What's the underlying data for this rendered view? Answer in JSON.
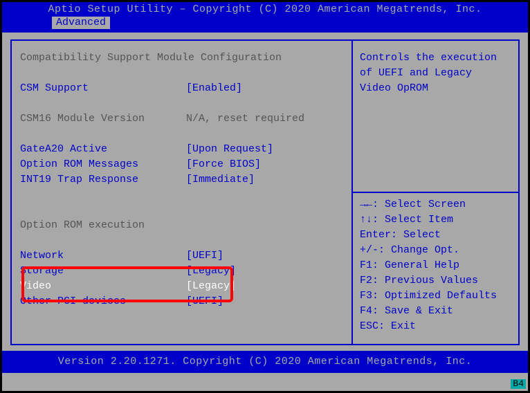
{
  "header": {
    "title": "Aptio Setup Utility – Copyright (C) 2020 American Megatrends, Inc.",
    "tab": "Advanced"
  },
  "left": {
    "section_title": "Compatibility Support Module Configuration",
    "csm_support": {
      "label": "CSM Support",
      "value": "[Enabled]"
    },
    "csm16": {
      "label": "CSM16 Module Version",
      "value": "N/A, reset required"
    },
    "gatea20": {
      "label": "GateA20 Active",
      "value": "[Upon Request]"
    },
    "oprom_msg": {
      "label": "Option ROM Messages",
      "value": "[Force BIOS]"
    },
    "int19": {
      "label": "INT19 Trap Response",
      "value": "[Immediate]"
    },
    "oprom_exec": "Option ROM execution",
    "network": {
      "label": "Network",
      "value": "[UEFI]"
    },
    "storage": {
      "label": "Storage",
      "value": "[Legacy]"
    },
    "video": {
      "label": "Video",
      "value": "[Legacy]"
    },
    "other_pci": {
      "label": "Other PCI devices",
      "value": "[UEFI]"
    }
  },
  "right": {
    "help1": "Controls the execution",
    "help2": "of UEFI and Legacy",
    "help3": "Video OpROM",
    "k1": "→←: Select Screen",
    "k2": "↑↓: Select Item",
    "k3": "Enter: Select",
    "k4": "+/-: Change Opt.",
    "k5": "F1: General Help",
    "k6": "F2: Previous Values",
    "k7": "F3: Optimized Defaults",
    "k8": "F4: Save & Exit",
    "k9": "ESC: Exit"
  },
  "footer": "Version 2.20.1271. Copyright (C) 2020 American Megatrends, Inc.",
  "badge": "B4"
}
